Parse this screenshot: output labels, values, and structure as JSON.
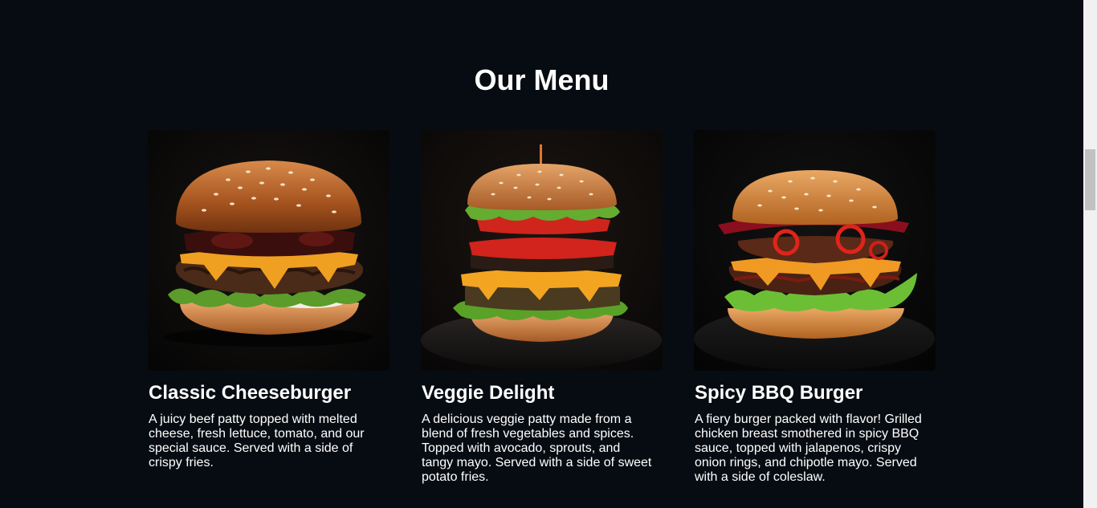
{
  "section": {
    "title": "Our Menu"
  },
  "menu": {
    "items": [
      {
        "name": "Classic Cheeseburger",
        "description": "A juicy beef patty topped with melted cheese, fresh lettuce, tomato, and our special sauce. Served with a side of crispy fries.",
        "image": "burger-photo"
      },
      {
        "name": "Veggie Delight",
        "description": "A delicious veggie patty made from a blend of fresh vegetables and spices. Topped with avocado, sprouts, and tangy mayo. Served with a side of sweet potato fries.",
        "image": "burger-photo"
      },
      {
        "name": "Spicy BBQ Burger",
        "description": "A fiery burger packed with flavor! Grilled chicken breast smothered in spicy BBQ sauce, topped with jalapenos, crispy onion rings, and chipotle mayo. Served with a side of coleslaw.",
        "image": "burger-photo"
      }
    ]
  },
  "colors": {
    "background": "#070c12",
    "text": "#ffffff",
    "scrollbar_track": "#f1f1f1",
    "scrollbar_thumb": "#c1c1c1"
  }
}
